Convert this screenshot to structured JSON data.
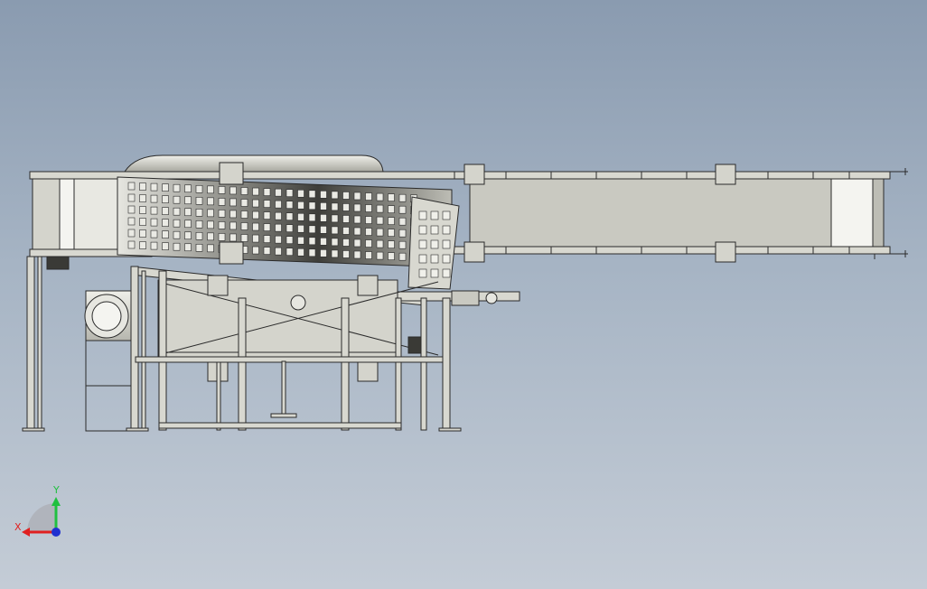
{
  "viewport": {
    "background_top": "#8a9bb0",
    "background_bottom": "#c4ccd6"
  },
  "model": {
    "line_color": "#2a2a2a",
    "body_fill": "#d4d4cc",
    "belt_fill": "#c9c9c1",
    "drum_dark": "#4a4a46",
    "drum_light": "#e6e6e0"
  },
  "triad": {
    "x_label": "X",
    "y_label": "Y",
    "x_color": "#e02020",
    "y_color": "#20c040",
    "z_color": "#2030d0"
  }
}
